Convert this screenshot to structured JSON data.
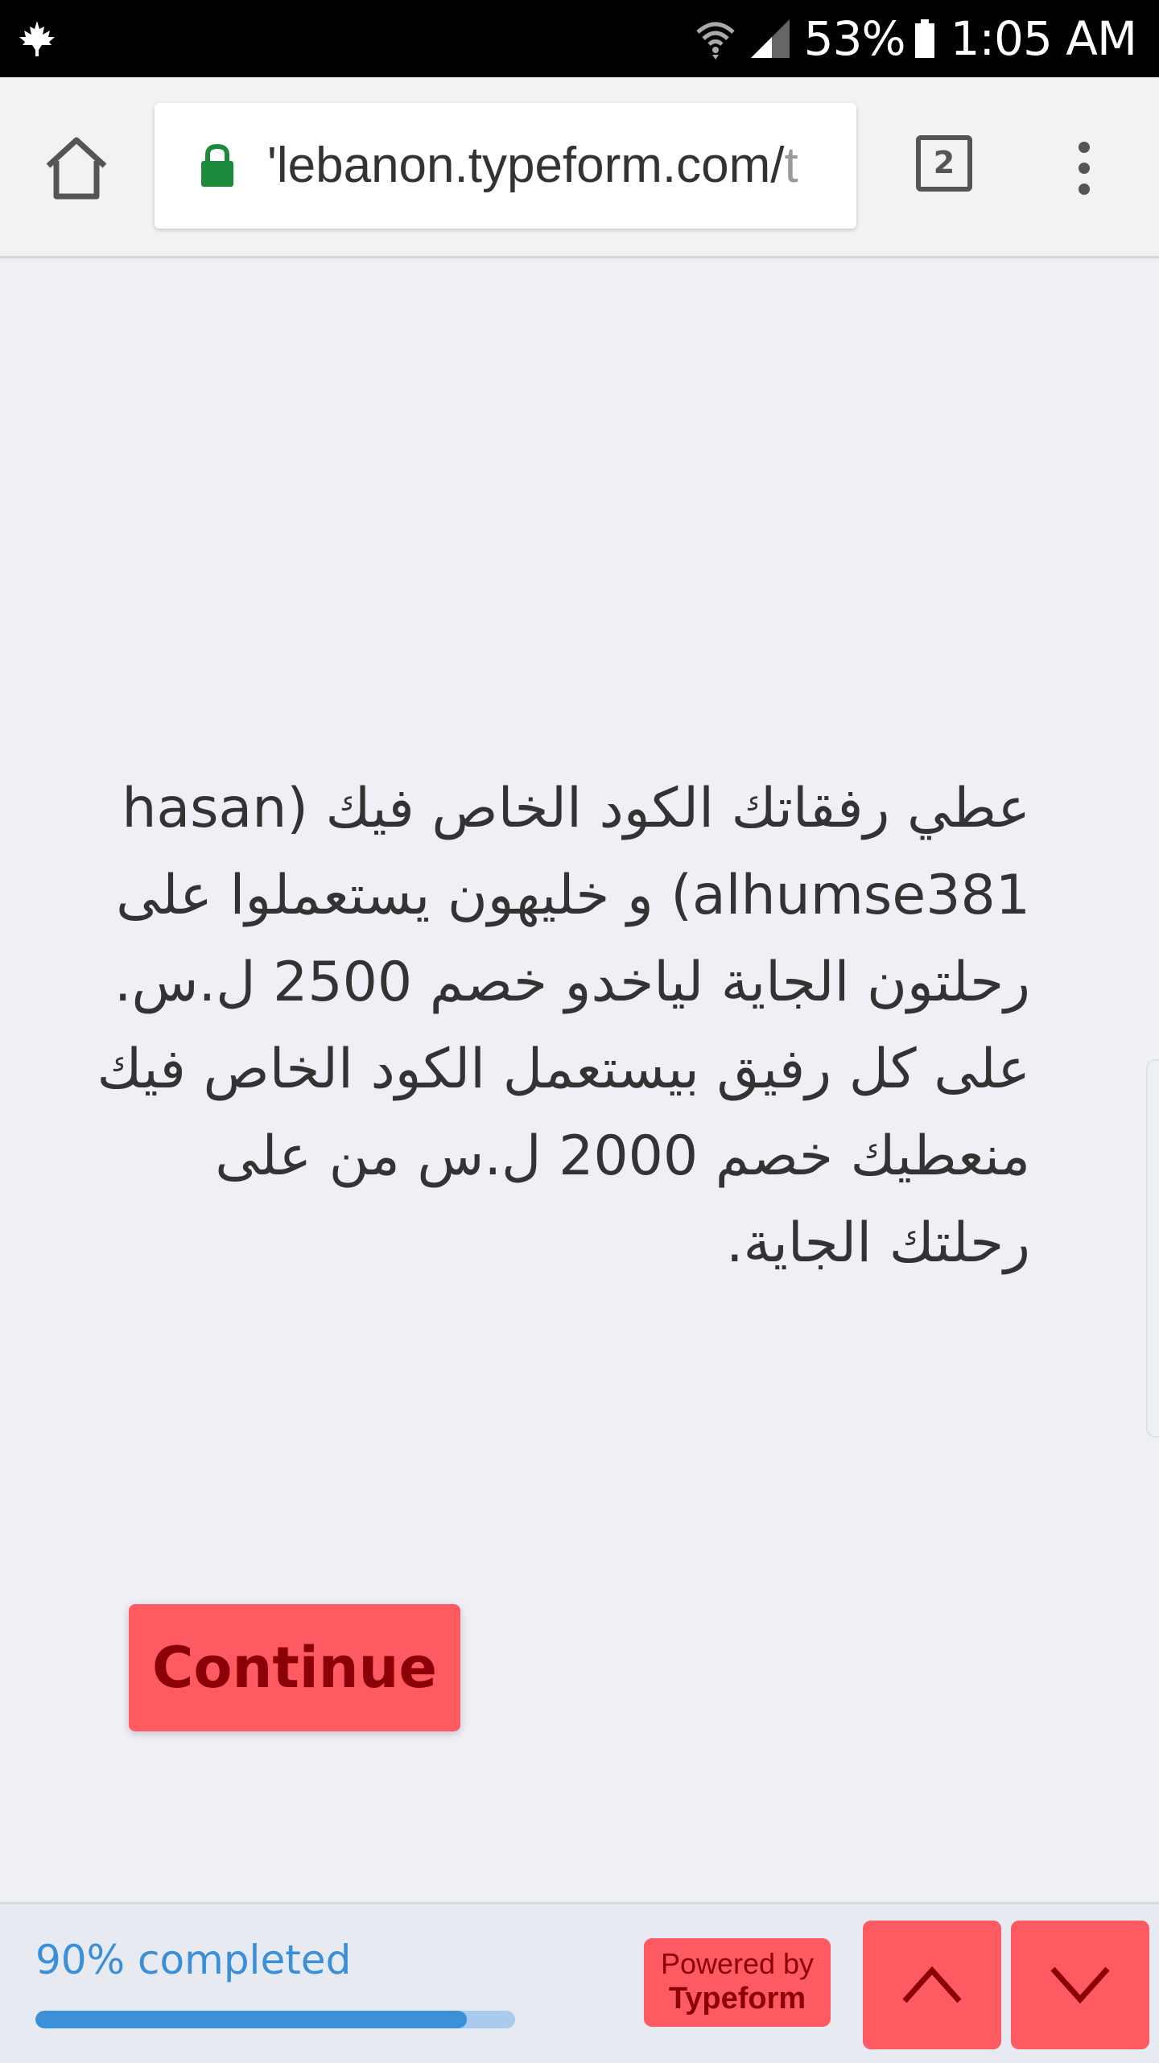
{
  "status_bar": {
    "battery_percent": "53%",
    "time": "1:05 AM",
    "icons": [
      "maple-leaf-icon",
      "wifi-icon",
      "signal-icon",
      "battery-icon"
    ]
  },
  "browser": {
    "url_main": "lebanon.typeform.com/",
    "url_partial_before": "'",
    "url_fade": "t",
    "tab_count": "2",
    "icons": [
      "home-icon",
      "lock-icon",
      "tabs-icon",
      "overflow-menu-icon"
    ],
    "lock_color": "#1b8a3a"
  },
  "question": {
    "lines": [
      "عطي رفقاتك الكود الخاص فيك (hasan",
      "alhumse381) و خليهون يستعملوا على",
      "رحلتون الجاية لياخدو خصم 2500 ل.س.",
      "على كل رفيق بيستعمل الكود الخاص فيك",
      "منعطيك خصم 2000 ل.س من على",
      "رحلتك الجاية."
    ]
  },
  "continue_button": {
    "label": "Continue",
    "color": "#fe5a61"
  },
  "footer": {
    "progress_label": "90% completed",
    "progress_fraction": 0.9,
    "powered_line1": "Powered by",
    "powered_line2": "Typeform",
    "nav_up_icon": "chevron-up-icon",
    "nav_down_icon": "chevron-down-icon",
    "accent_color": "#3b90d8"
  }
}
